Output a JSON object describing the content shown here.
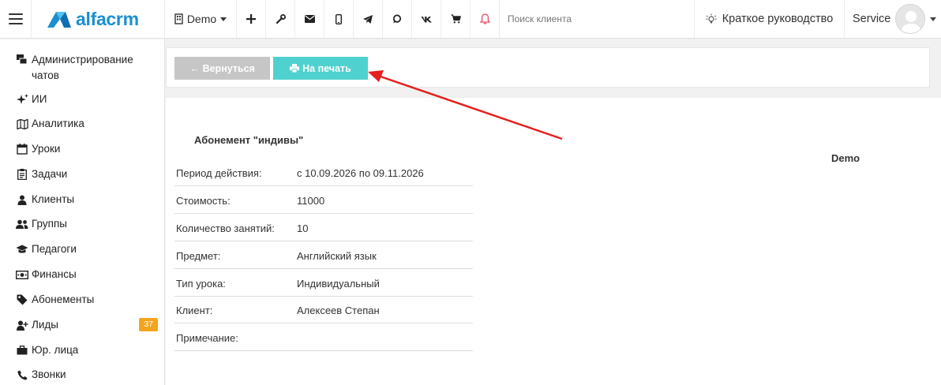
{
  "header": {
    "logo_text": "alfacrm",
    "branch": "Demo",
    "search_placeholder": "Поиск клиента",
    "guide_label": "Краткое руководство",
    "user_name": "Service",
    "icons": [
      "plus-icon",
      "wrench-icon",
      "mail-icon",
      "mobile-icon",
      "telegram-icon",
      "whatsapp-icon",
      "vk-icon",
      "cart-icon",
      "bell-icon"
    ],
    "bell_color": "#e84a5f"
  },
  "sidebar": {
    "items": [
      {
        "label": "Администрирование чатов",
        "icon": "chat-admin-icon"
      },
      {
        "label": "ИИ",
        "icon": "sparkle-icon"
      },
      {
        "label": "Аналитика",
        "icon": "map-icon"
      },
      {
        "label": "Уроки",
        "icon": "calendar-icon"
      },
      {
        "label": "Задачи",
        "icon": "clipboard-icon"
      },
      {
        "label": "Клиенты",
        "icon": "user-icon"
      },
      {
        "label": "Группы",
        "icon": "users-icon"
      },
      {
        "label": "Педагоги",
        "icon": "graduation-cap-icon"
      },
      {
        "label": "Финансы",
        "icon": "money-icon"
      },
      {
        "label": "Абонементы",
        "icon": "tag-icon"
      },
      {
        "label": "Лиды",
        "icon": "user-plus-icon",
        "badge": "37"
      },
      {
        "label": "Юр. лица",
        "icon": "briefcase-icon"
      },
      {
        "label": "Звонки",
        "icon": "phone-icon"
      }
    ],
    "badge_color": "#f5a41e"
  },
  "toolbar": {
    "back_label": "Вернуться",
    "print_label": "На печать",
    "back_color": "#c6c6c6",
    "print_color": "#4fd2cf"
  },
  "document": {
    "title": "Абонемент \"индивы\"",
    "branch": "Demo",
    "rows": [
      {
        "key": "Период действия:",
        "value": "с 10.09.2026 по 09.11.2026"
      },
      {
        "key": "Стоимость:",
        "value": "11000"
      },
      {
        "key": "Количество занятий:",
        "value": "10"
      },
      {
        "key": "Предмет:",
        "value": "Английский язык"
      },
      {
        "key": "Тип урока:",
        "value": "Индивидуальный"
      },
      {
        "key": "Клиент:",
        "value": "Алексеев Степан"
      },
      {
        "key": "Примечание:",
        "value": ""
      }
    ]
  },
  "annotation": {
    "arrow_color": "#e5201d"
  }
}
